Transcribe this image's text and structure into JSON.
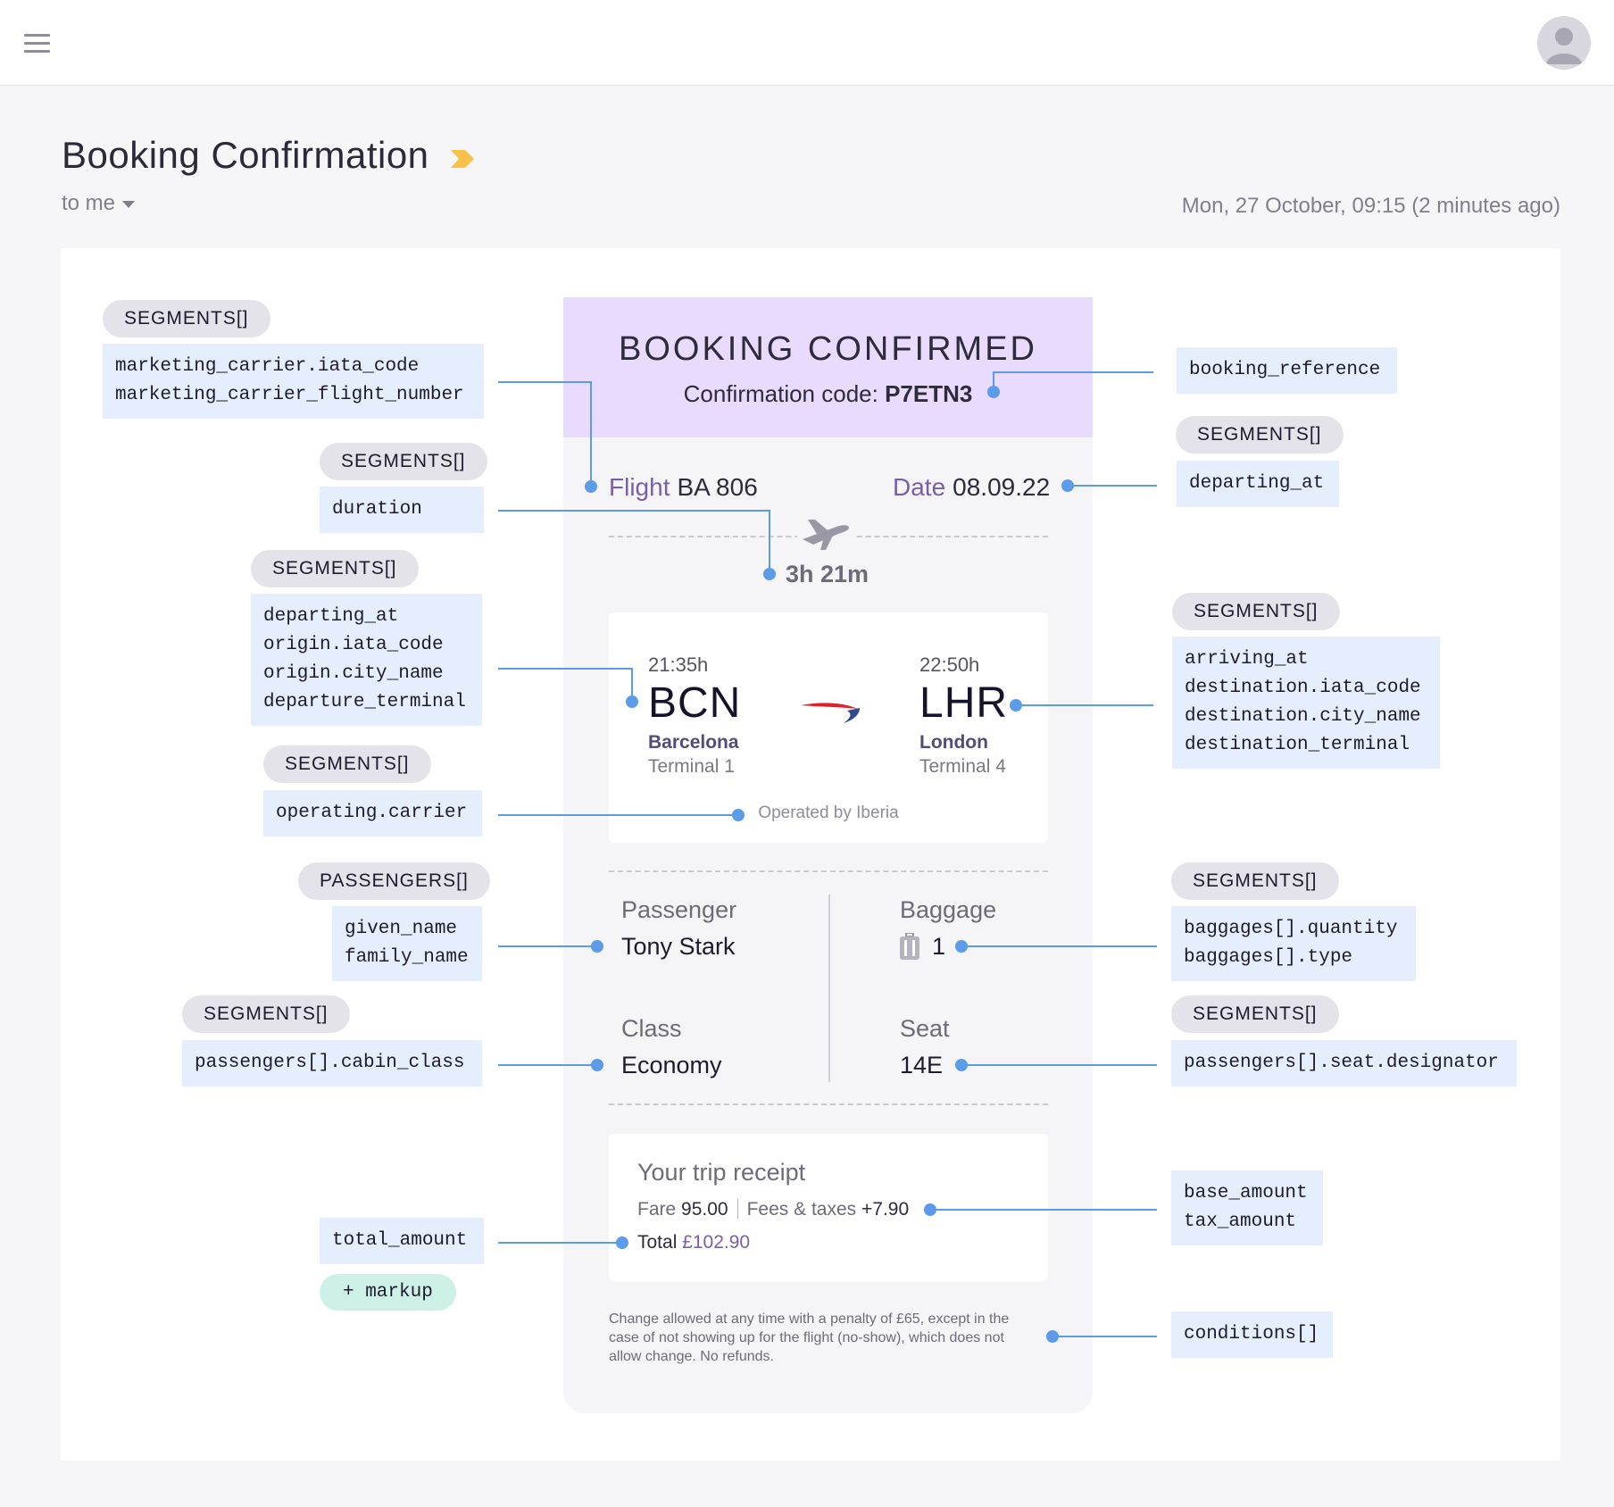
{
  "mail": {
    "title": "Booking Confirmation",
    "recipient": "to me",
    "date": "Mon, 27 October, 09:15 (2 minutes ago)"
  },
  "colors": {
    "accent": "#7a5fa8",
    "hero": "#e8dbfd",
    "field_bg": "#e4eefc",
    "connector": "#5b9be8",
    "label_marker": "#f8c24a"
  },
  "email": {
    "hero_title": "BOOKING CONFIRMED",
    "confirmation_label": "Confirmation code:",
    "confirmation_code": "P7ETN3",
    "flight_label": "Flight",
    "flight_value": "BA 806",
    "date_label": "Date",
    "date_value": "08.09.22",
    "duration": "3h 21m",
    "origin": {
      "time": "21:35h",
      "iata": "BCN",
      "city": "Barcelona",
      "terminal": "Terminal 1"
    },
    "destination": {
      "time": "22:50h",
      "iata": "LHR",
      "city": "London",
      "terminal": "Terminal 4"
    },
    "operated_by": "Operated by Iberia",
    "passenger_label": "Passenger",
    "passenger_value": "Tony Stark",
    "baggage_label": "Baggage",
    "baggage_value": "1",
    "class_label": "Class",
    "class_value": "Economy",
    "seat_label": "Seat",
    "seat_value": "14E",
    "receipt_title": "Your trip receipt",
    "fare_label": "Fare",
    "fare_value": "95.00",
    "fees_label": "Fees & taxes",
    "fees_value": "+7.90",
    "total_label": "Total",
    "total_value": "£102.90",
    "conditions": "Change allowed at any time with a penalty of £65, except in the case of not showing up for the flight (no-show), which does not allow change. No refunds."
  },
  "annotations": {
    "segments_label": "SEGMENTS[]",
    "passengers_label": "PASSENGERS[]",
    "carrier_fields": "marketing_carrier.iata_code\nmarketing_carrier_flight_number",
    "duration_field": "duration",
    "origin_fields": "departing_at\norigin.iata_code\norigin.city_name\ndeparture_terminal",
    "operating_field": "operating.carrier",
    "passenger_fields": "given_name\nfamily_name",
    "cabin_field": "passengers[].cabin_class",
    "total_field": "total_amount",
    "markup_label": "+ markup",
    "booking_ref_field": "booking_reference",
    "departing_field": "departing_at",
    "destination_fields": "arriving_at\ndestination.iata_code\ndestination.city_name\ndestination_terminal",
    "baggage_fields": "baggages[].quantity\nbaggages[].type",
    "seat_field": "passengers[].seat.designator",
    "amount_fields": "base_amount\ntax_amount",
    "conditions_field": "conditions[]"
  }
}
